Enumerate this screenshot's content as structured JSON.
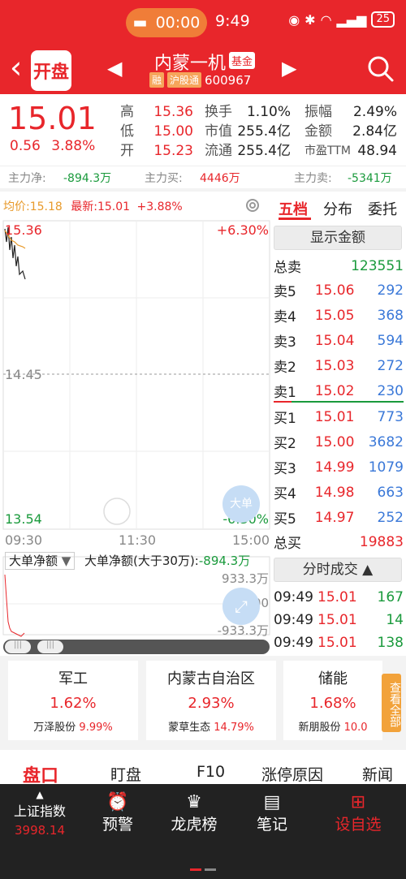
{
  "status": {
    "time_pill": "00:00",
    "clock": "9:49",
    "battery": "25"
  },
  "nav": {
    "kaipan": "开盘",
    "name": "内蒙一机",
    "badge": "基金",
    "tag_rong": "融",
    "tag_hgt": "沪股通",
    "code": "600967"
  },
  "quote": {
    "price": "15.01",
    "change": "0.56",
    "pct": "3.88%",
    "col1": [
      {
        "l": "高",
        "v": "15.36"
      },
      {
        "l": "低",
        "v": "15.00"
      },
      {
        "l": "开",
        "v": "15.23"
      }
    ],
    "col2": [
      {
        "l": "换手",
        "v": "1.10%"
      },
      {
        "l": "市值",
        "v": "255.4亿"
      },
      {
        "l": "流通",
        "v": "255.4亿"
      }
    ],
    "col3": [
      {
        "l": "振幅",
        "v": "2.49%"
      },
      {
        "l": "金额",
        "v": "2.84亿"
      },
      {
        "l": "市盈TTM",
        "v": "48.94"
      }
    ]
  },
  "mainforce": {
    "l1": "主力净:",
    "v1": "-894.3万",
    "l2": "主力买:",
    "v2": "4446万",
    "l3": "主力卖:",
    "v3": "-5341万"
  },
  "chart": {
    "avg": "均价:15.18",
    "latest": "最新:15.01",
    "pct": "+3.88%",
    "top_price": "15.36",
    "top_pct": "+6.30%",
    "mid_price": "14.45",
    "bot_price": "13.54",
    "bot_pct": "-6.30%",
    "times": [
      "09:30",
      "11:30",
      "15:00"
    ],
    "big_order_btn": "大单",
    "net_select": "大单净额",
    "net_label": "大单净额(大于30万):",
    "net_value": "-894.3万",
    "sub_top": "933.3万",
    "sub_mid": "0.00",
    "sub_bot": "-933.3万"
  },
  "orderbook": {
    "tabs": [
      "五档",
      "分布",
      "委托"
    ],
    "show_amount": "显示金额",
    "total_sell_label": "总卖",
    "total_sell": "123551",
    "sells": [
      {
        "l": "卖5",
        "p": "15.06",
        "v": "292"
      },
      {
        "l": "卖4",
        "p": "15.05",
        "v": "368"
      },
      {
        "l": "卖3",
        "p": "15.04",
        "v": "594"
      },
      {
        "l": "卖2",
        "p": "15.03",
        "v": "272"
      },
      {
        "l": "卖1",
        "p": "15.02",
        "v": "230"
      }
    ],
    "buys": [
      {
        "l": "买1",
        "p": "15.01",
        "v": "773"
      },
      {
        "l": "买2",
        "p": "15.00",
        "v": "3682"
      },
      {
        "l": "买3",
        "p": "14.99",
        "v": "1079"
      },
      {
        "l": "买4",
        "p": "14.98",
        "v": "663"
      },
      {
        "l": "买5",
        "p": "14.97",
        "v": "252"
      }
    ],
    "total_buy_label": "总买",
    "total_buy": "19883",
    "ticks_btn": "分时成交",
    "ticks": [
      {
        "t": "09:49",
        "p": "15.01",
        "v": "167"
      },
      {
        "t": "09:49",
        "p": "15.01",
        "v": "14"
      },
      {
        "t": "09:49",
        "p": "15.01",
        "v": "138"
      }
    ]
  },
  "sectors": [
    {
      "name": "军工",
      "pct": "1.62%",
      "lead": "万泽股份",
      "lead_pct": "9.99%"
    },
    {
      "name": "内蒙古自治区",
      "pct": "2.93%",
      "lead": "蒙草生态",
      "lead_pct": "14.79%"
    },
    {
      "name": "储能",
      "pct": "1.68%",
      "lead": "新朋股份",
      "lead_pct": "10.0"
    }
  ],
  "view_all": "查看全部",
  "bottom_tabs": [
    "盘口",
    "盯盘",
    "F10",
    "涨停原因",
    "新闻"
  ],
  "dock": {
    "index_name": "上证指数",
    "index_value": "3998.14",
    "items": [
      "预警",
      "龙虎榜",
      "笔记",
      "设自选"
    ]
  }
}
